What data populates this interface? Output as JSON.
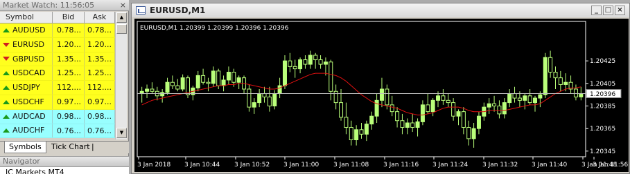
{
  "market_watch": {
    "title": "Market Watch: 11:56:05",
    "close_label": "×",
    "columns": {
      "symbol": "Symbol",
      "bid": "Bid",
      "ask": "Ask"
    },
    "rows": [
      {
        "symbol": "AUDUSD",
        "bid": "0.78...",
        "ask": "0.78...",
        "direction": "up",
        "color": "yellow"
      },
      {
        "symbol": "EURUSD",
        "bid": "1.20...",
        "ask": "1.20...",
        "direction": "down",
        "color": "yellow"
      },
      {
        "symbol": "GBPUSD",
        "bid": "1.35...",
        "ask": "1.35...",
        "direction": "down",
        "color": "yellow"
      },
      {
        "symbol": "USDCAD",
        "bid": "1.25...",
        "ask": "1.25...",
        "direction": "up",
        "color": "yellow"
      },
      {
        "symbol": "USDJPY",
        "bid": "112....",
        "ask": "112....",
        "direction": "up",
        "color": "yellow"
      },
      {
        "symbol": "USDCHF",
        "bid": "0.97...",
        "ask": "0.97...",
        "direction": "up",
        "color": "yellow"
      },
      {
        "symbol": "AUDCAD",
        "bid": "0.98...",
        "ask": "0.98...",
        "direction": "up",
        "color": "cyan"
      },
      {
        "symbol": "AUDCHF",
        "bid": "0.76...",
        "ask": "0.76...",
        "direction": "up",
        "color": "cyan"
      }
    ],
    "tabs": [
      "Symbols",
      "Tick Chart"
    ],
    "active_tab": "Symbols",
    "tab_separator": "|"
  },
  "navigator": {
    "title": "Navigator",
    "first_item": "IC Markets MT4"
  },
  "chart_window": {
    "title": "EURUSD,M1",
    "buttons": {
      "minimize": "_",
      "maximize": "□",
      "close": "×"
    }
  },
  "colors": {
    "bull_candle": "#baff7a",
    "bear_candle": "#000000",
    "ma_line": "#e01010",
    "bid_line": "#c0c0c0",
    "axis": "#ffffff",
    "market_yellow": "#ffff1e",
    "market_cyan": "#98ffff"
  },
  "chart_data": {
    "type": "candlestick",
    "header": "EURUSD,M1  1.20399 1.20399 1.20396 1.20396",
    "symbol": "EURUSD",
    "timeframe": "M1",
    "current_price": 1.20396,
    "current_price_label": "1.20396",
    "ylim": [
      1.2034,
      1.2046
    ],
    "yticks": [
      1.20425,
      1.20405,
      1.20385,
      1.20365,
      1.20345
    ],
    "ytick_labels": [
      "1.20425",
      "1.20405",
      "1.20385",
      "1.20365",
      "1.20345"
    ],
    "xtick_labels": [
      "3 Jan 2018",
      "3 Jan 10:44",
      "3 Jan 10:52",
      "3 Jan 11:00",
      "3 Jan 11:08",
      "3 Jan 11:16",
      "3 Jan 11:24",
      "3 Jan 11:32",
      "3 Jan 11:40",
      "3 Jan 11:48",
      "3 Jan 11:56"
    ],
    "ohlc": [
      [
        1.20396,
        1.20402,
        1.20388,
        1.20398
      ],
      [
        1.20398,
        1.20404,
        1.20392,
        1.204
      ],
      [
        1.204,
        1.20406,
        1.20396,
        1.20398
      ],
      [
        1.20398,
        1.20402,
        1.2039,
        1.20394
      ],
      [
        1.20394,
        1.204,
        1.20388,
        1.20397
      ],
      [
        1.20397,
        1.2041,
        1.20395,
        1.20406
      ],
      [
        1.20406,
        1.20412,
        1.204,
        1.20403
      ],
      [
        1.20403,
        1.20409,
        1.20398,
        1.204
      ],
      [
        1.204,
        1.20413,
        1.20398,
        1.2041
      ],
      [
        1.2041,
        1.20412,
        1.20392,
        1.20395
      ],
      [
        1.20395,
        1.20403,
        1.2039,
        1.20401
      ],
      [
        1.20401,
        1.20416,
        1.20398,
        1.20412
      ],
      [
        1.20412,
        1.20418,
        1.20404,
        1.20406
      ],
      [
        1.20406,
        1.2041,
        1.20398,
        1.20405
      ],
      [
        1.20405,
        1.2042,
        1.20402,
        1.20416
      ],
      [
        1.20416,
        1.20418,
        1.204,
        1.20403
      ],
      [
        1.20403,
        1.20412,
        1.20398,
        1.20408
      ],
      [
        1.20408,
        1.2042,
        1.20404,
        1.20415
      ],
      [
        1.20415,
        1.20418,
        1.20402,
        1.20406
      ],
      [
        1.20406,
        1.20412,
        1.204,
        1.2041
      ],
      [
        1.2041,
        1.20412,
        1.20396,
        1.204
      ],
      [
        1.204,
        1.20404,
        1.2038,
        1.20384
      ],
      [
        1.20384,
        1.20392,
        1.20378,
        1.20388
      ],
      [
        1.20388,
        1.204,
        1.20384,
        1.20396
      ],
      [
        1.20396,
        1.20402,
        1.20388,
        1.20393
      ],
      [
        1.20393,
        1.20402,
        1.2038,
        1.20385
      ],
      [
        1.20385,
        1.20399,
        1.20382,
        1.20396
      ],
      [
        1.20396,
        1.2041,
        1.20392,
        1.20403
      ],
      [
        1.20403,
        1.2043,
        1.204,
        1.20425
      ],
      [
        1.20425,
        1.20432,
        1.20415,
        1.2042
      ],
      [
        1.2042,
        1.20426,
        1.2041,
        1.20418
      ],
      [
        1.20418,
        1.20428,
        1.20414,
        1.20426
      ],
      [
        1.20426,
        1.2043,
        1.20418,
        1.20422
      ],
      [
        1.20422,
        1.20434,
        1.20418,
        1.2043
      ],
      [
        1.2043,
        1.20432,
        1.20418,
        1.20426
      ],
      [
        1.20426,
        1.2043,
        1.20418,
        1.20422
      ],
      [
        1.20422,
        1.20428,
        1.20412,
        1.20424
      ],
      [
        1.20424,
        1.20426,
        1.2039,
        1.20398
      ],
      [
        1.20398,
        1.20404,
        1.20382,
        1.20388
      ],
      [
        1.20388,
        1.204,
        1.20372,
        1.20375
      ],
      [
        1.20375,
        1.20388,
        1.2036,
        1.20366
      ],
      [
        1.20366,
        1.20372,
        1.2035,
        1.20355
      ],
      [
        1.20355,
        1.20368,
        1.2035,
        1.20364
      ],
      [
        1.20364,
        1.2037,
        1.20356,
        1.2036
      ],
      [
        1.2036,
        1.20372,
        1.20354,
        1.20369
      ],
      [
        1.20369,
        1.2038,
        1.20364,
        1.20376
      ],
      [
        1.20376,
        1.20396,
        1.2037,
        1.2039
      ],
      [
        1.2039,
        1.2041,
        1.20384,
        1.204
      ],
      [
        1.204,
        1.20404,
        1.20382,
        1.20386
      ],
      [
        1.20386,
        1.20394,
        1.20376,
        1.2038
      ],
      [
        1.2038,
        1.20384,
        1.20366,
        1.20372
      ],
      [
        1.20372,
        1.20378,
        1.2036,
        1.20366
      ],
      [
        1.20366,
        1.20374,
        1.2036,
        1.2037
      ],
      [
        1.2037,
        1.20378,
        1.20362,
        1.20366
      ],
      [
        1.20366,
        1.20374,
        1.20358,
        1.20371
      ],
      [
        1.20371,
        1.2039,
        1.20368,
        1.20386
      ],
      [
        1.20386,
        1.20396,
        1.20378,
        1.2038
      ],
      [
        1.2038,
        1.20392,
        1.20376,
        1.2039
      ],
      [
        1.2039,
        1.20398,
        1.20384,
        1.20394
      ],
      [
        1.20394,
        1.204,
        1.20386,
        1.2039
      ],
      [
        1.2039,
        1.20396,
        1.20384,
        1.20388
      ],
      [
        1.20388,
        1.20392,
        1.20372,
        1.20376
      ],
      [
        1.20376,
        1.20382,
        1.20368,
        1.2038
      ],
      [
        1.2038,
        1.20384,
        1.2036,
        1.20366
      ],
      [
        1.20366,
        1.20372,
        1.2035,
        1.20356
      ],
      [
        1.20356,
        1.2037,
        1.20348,
        1.20365
      ],
      [
        1.20365,
        1.2038,
        1.2036,
        1.20376
      ],
      [
        1.20376,
        1.20388,
        1.20372,
        1.20384
      ],
      [
        1.20384,
        1.20392,
        1.20378,
        1.20387
      ],
      [
        1.20387,
        1.20394,
        1.2038,
        1.20385
      ],
      [
        1.20385,
        1.2039,
        1.20374,
        1.20378
      ],
      [
        1.20378,
        1.20392,
        1.20374,
        1.20388
      ],
      [
        1.20388,
        1.204,
        1.20384,
        1.20396
      ],
      [
        1.20396,
        1.20402,
        1.20388,
        1.20392
      ],
      [
        1.20392,
        1.20398,
        1.20384,
        1.2039
      ],
      [
        1.2039,
        1.20396,
        1.20382,
        1.20394
      ],
      [
        1.20394,
        1.204,
        1.20386,
        1.20388
      ],
      [
        1.20388,
        1.20394,
        1.2038,
        1.20392
      ],
      [
        1.20392,
        1.20398,
        1.20384,
        1.20395
      ],
      [
        1.20395,
        1.20432,
        1.20392,
        1.20428
      ],
      [
        1.20428,
        1.20434,
        1.2041,
        1.20415
      ],
      [
        1.20415,
        1.2042,
        1.204,
        1.2041
      ],
      [
        1.2041,
        1.20416,
        1.20398,
        1.20404
      ],
      [
        1.20404,
        1.20414,
        1.20398,
        1.20406
      ],
      [
        1.20406,
        1.20412,
        1.20396,
        1.204
      ],
      [
        1.204,
        1.20404,
        1.2039,
        1.20393
      ],
      [
        1.20393,
        1.20402,
        1.2039,
        1.20396
      ]
    ],
    "ma_values": [
      1.20386,
      1.20388,
      1.2039,
      1.20391,
      1.20392,
      1.20393,
      1.20394,
      1.20395,
      1.20396,
      1.20397,
      1.20398,
      1.20399,
      1.204,
      1.20401,
      1.20402,
      1.20403,
      1.20403,
      1.20404,
      1.20404,
      1.20405,
      1.20405,
      1.20404,
      1.20403,
      1.20402,
      1.20401,
      1.204,
      1.204,
      1.20401,
      1.20403,
      1.20405,
      1.20407,
      1.20409,
      1.20411,
      1.20413,
      1.20414,
      1.20414,
      1.20414,
      1.20413,
      1.20412,
      1.2041,
      1.20407,
      1.20403,
      1.20399,
      1.20395,
      1.20392,
      1.20389,
      1.20387,
      1.20386,
      1.20385,
      1.20384,
      1.20383,
      1.20381,
      1.20379,
      1.20378,
      1.20377,
      1.20377,
      1.20378,
      1.20379,
      1.20381,
      1.20383,
      1.20384,
      1.20384,
      1.20384,
      1.20383,
      1.20381,
      1.2038,
      1.2038,
      1.2038,
      1.20381,
      1.20381,
      1.20381,
      1.20381,
      1.20382,
      1.20383,
      1.20384,
      1.20385,
      1.20386,
      1.20386,
      1.20387,
      1.2039,
      1.20393,
      1.20396,
      1.20398,
      1.204,
      1.20401,
      1.20401,
      1.20402
    ]
  }
}
